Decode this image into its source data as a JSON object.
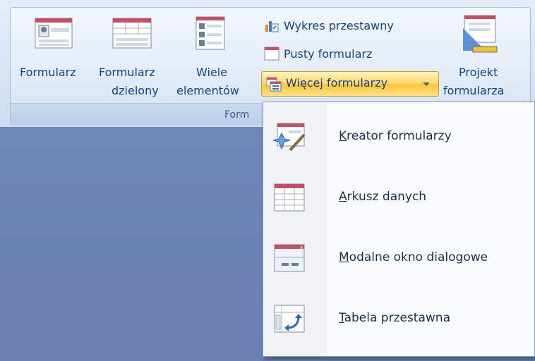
{
  "ribbon": {
    "group_label": "Form",
    "buttons": {
      "form": "Formularz",
      "split_form_line1": "Formularz",
      "split_form_line2": "dzielony",
      "multiple_line1": "Wiele",
      "multiple_line2": "elementów",
      "pivot_chart": "Wykres przestawny",
      "blank_form": "Pusty formularz",
      "more_forms": "Więcej formularzy",
      "design_line1": "Projekt",
      "design_line2": "formularza"
    }
  },
  "menu": {
    "items": [
      {
        "key": "K",
        "rest": "reator formularzy",
        "icon": "form-wizard-icon"
      },
      {
        "key": "A",
        "rest": "rkusz danych",
        "icon": "datasheet-icon"
      },
      {
        "key": "M",
        "rest": "odalne okno dialogowe",
        "icon": "modal-dialog-icon"
      },
      {
        "key": "T",
        "rest": "abela przestawna",
        "icon": "pivot-table-icon"
      }
    ]
  },
  "colors": {
    "ribbon_text": "#15428b",
    "background": "#6d83b5",
    "highlight": "#ffd866"
  }
}
